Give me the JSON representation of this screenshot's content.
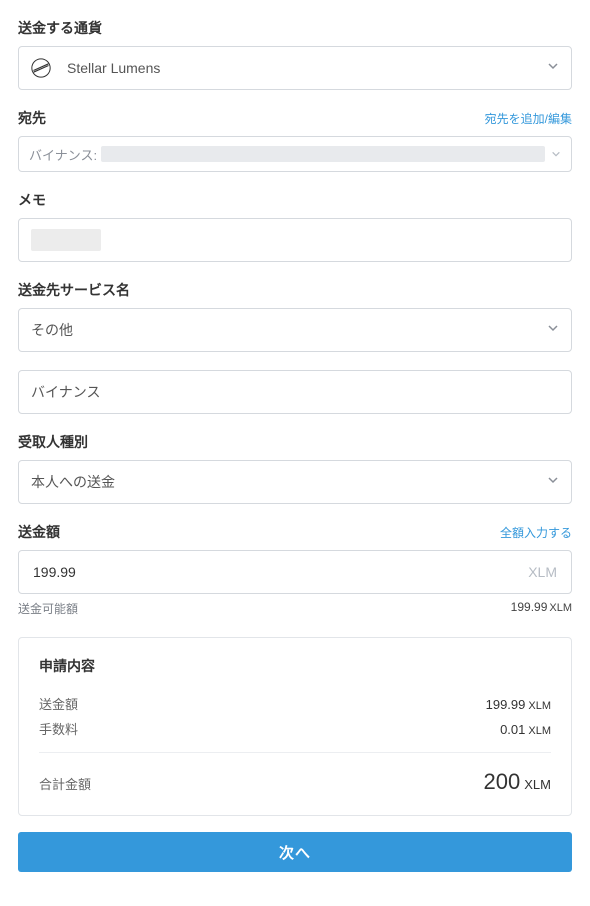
{
  "currency": {
    "label": "送金する通貨",
    "selected": "Stellar Lumens"
  },
  "destination": {
    "label": "宛先",
    "edit_link": "宛先を追加/編集",
    "prefix": "バイナンス:"
  },
  "memo": {
    "label": "メモ"
  },
  "service": {
    "label": "送金先サービス名",
    "selected": "その他",
    "custom_value": "バイナンス"
  },
  "recipient_type": {
    "label": "受取人種別",
    "selected": "本人への送金"
  },
  "amount": {
    "label": "送金額",
    "fill_all": "全額入力する",
    "value": "199.99",
    "unit": "XLM",
    "available_label": "送金可能額",
    "available_value": "199.99",
    "available_unit": "XLM"
  },
  "summary": {
    "title": "申請内容",
    "send_label": "送金額",
    "send_value": "199.99",
    "send_unit": "XLM",
    "fee_label": "手数料",
    "fee_value": "0.01",
    "fee_unit": "XLM",
    "total_label": "合計金額",
    "total_value": "200",
    "total_unit": "XLM"
  },
  "next_button": "次へ"
}
